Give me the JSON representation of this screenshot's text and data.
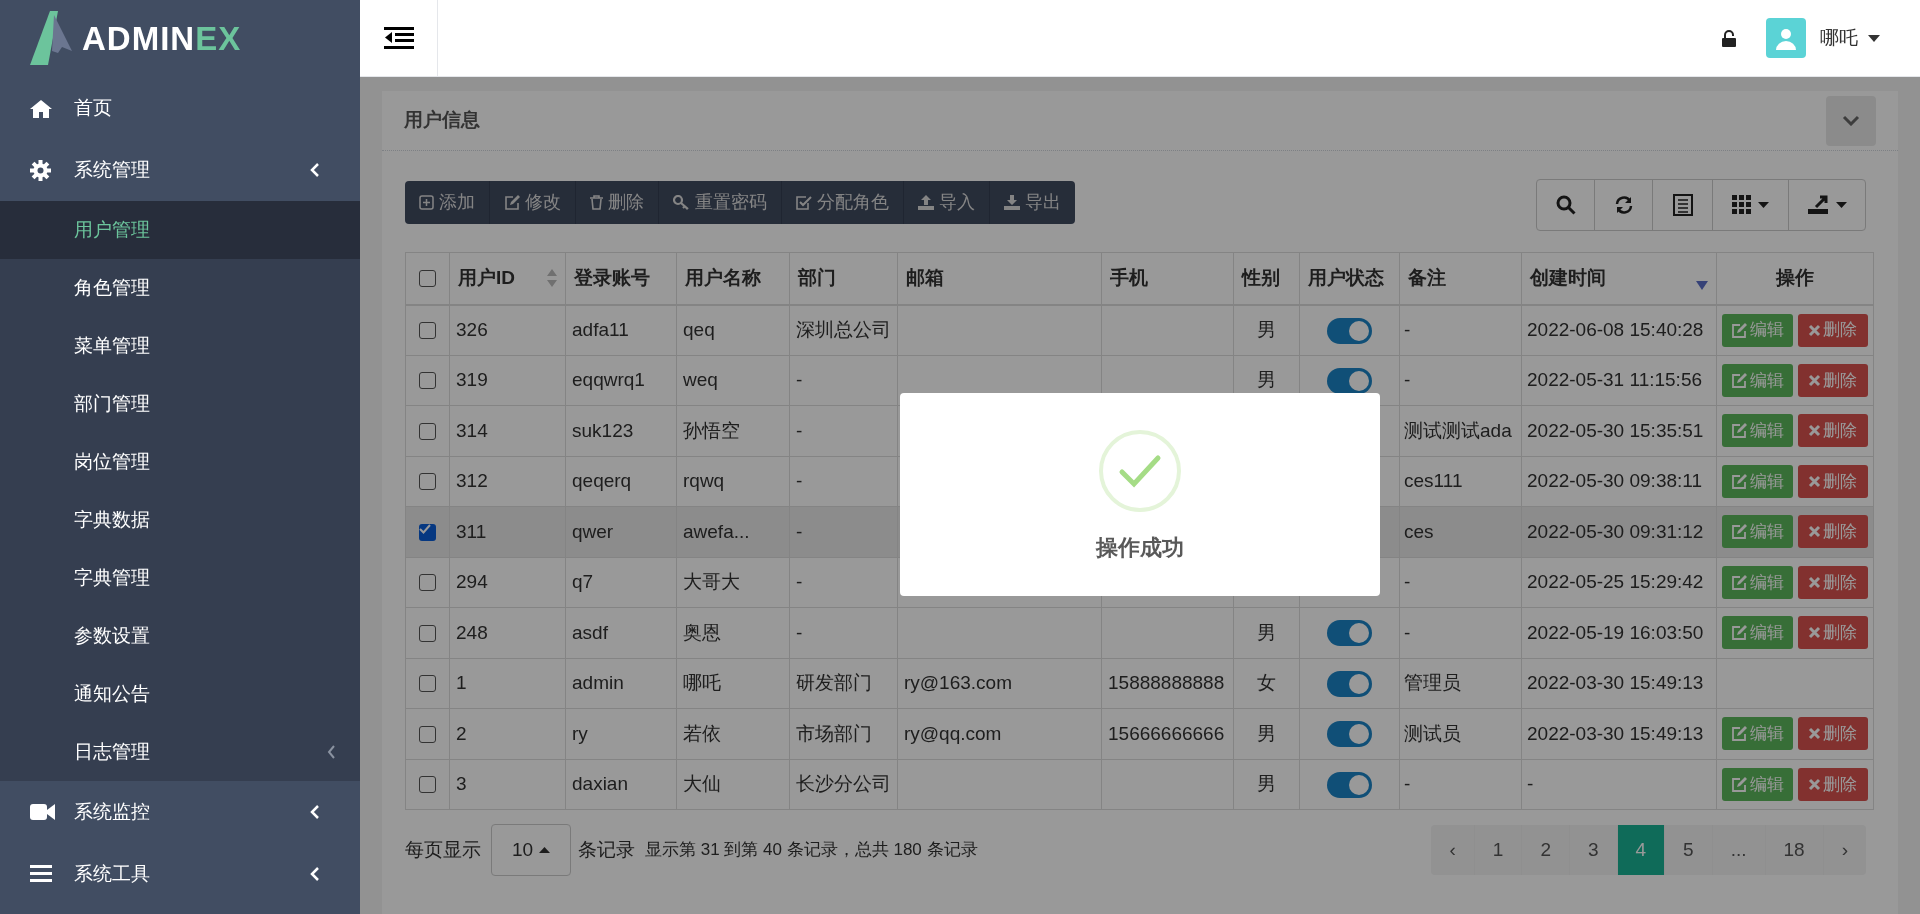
{
  "logo": {
    "text_main": "ADMIN",
    "text_accent": "EX"
  },
  "sidebar": {
    "items": [
      {
        "label": "首页",
        "has_submenu": false
      },
      {
        "label": "系统管理",
        "has_submenu": true,
        "children": [
          {
            "label": "用户管理",
            "selected": true,
            "has_submenu": false
          },
          {
            "label": "角色管理",
            "selected": false,
            "has_submenu": false
          },
          {
            "label": "菜单管理",
            "selected": false,
            "has_submenu": false
          },
          {
            "label": "部门管理",
            "selected": false,
            "has_submenu": false
          },
          {
            "label": "岗位管理",
            "selected": false,
            "has_submenu": false
          },
          {
            "label": "字典数据",
            "selected": false,
            "has_submenu": false
          },
          {
            "label": "字典管理",
            "selected": false,
            "has_submenu": false
          },
          {
            "label": "参数设置",
            "selected": false,
            "has_submenu": false
          },
          {
            "label": "通知公告",
            "selected": false,
            "has_submenu": false
          },
          {
            "label": "日志管理",
            "selected": false,
            "has_submenu": true
          }
        ]
      },
      {
        "label": "系统监控",
        "has_submenu": true
      },
      {
        "label": "系统工具",
        "has_submenu": true
      }
    ]
  },
  "header": {
    "user_name": "哪吒"
  },
  "panel": {
    "title": "用户信息"
  },
  "toolbar": {
    "buttons": [
      "添加",
      "修改",
      "删除",
      "重置密码",
      "分配角色",
      "导入",
      "导出"
    ]
  },
  "table": {
    "select_all_checked": false,
    "columns": [
      {
        "label": "用户ID",
        "sorted_desc": false
      },
      {
        "label": "登录账号"
      },
      {
        "label": "用户名称"
      },
      {
        "label": "部门"
      },
      {
        "label": "邮箱"
      },
      {
        "label": "手机"
      },
      {
        "label": "性别"
      },
      {
        "label": "用户状态"
      },
      {
        "label": "备注"
      },
      {
        "label": "创建时间",
        "sorted_desc": true
      },
      {
        "label": "操作"
      }
    ],
    "rows": [
      {
        "checked": false,
        "cells": [
          "326",
          "adfa11",
          "qeq",
          "深圳总公司",
          "",
          "",
          "男"
        ],
        "status_on": true,
        "remark": "-",
        "created": "2022-06-08 15:40:28",
        "actions": [
          "编辑",
          "删除"
        ]
      },
      {
        "checked": false,
        "cells": [
          "319",
          "eqqwrq1",
          "weq",
          "-",
          "",
          "",
          "男"
        ],
        "status_on": true,
        "remark": "-",
        "created": "2022-05-31 11:15:56",
        "actions": [
          "编辑",
          "删除"
        ]
      },
      {
        "checked": false,
        "cells": [
          "314",
          "suk123",
          "孙悟空",
          "-"
        ],
        "remark": "测试测试ada",
        "created": "2022-05-30 15:35:51",
        "actions": [
          "编辑",
          "删除"
        ]
      },
      {
        "checked": false,
        "cells": [
          "312",
          "qeqerq",
          "rqwq",
          "-"
        ],
        "remark": "ces111",
        "created": "2022-05-30 09:38:11",
        "actions": [
          "编辑",
          "删除"
        ]
      },
      {
        "checked": true,
        "cells": [
          "311",
          "qwer",
          "awefa...",
          "-"
        ],
        "remark": "ces",
        "created": "2022-05-30 09:31:12",
        "actions": [
          "编辑",
          "删除"
        ]
      },
      {
        "checked": false,
        "cells": [
          "294",
          "q7",
          "大哥大",
          "-"
        ],
        "remark": "-",
        "created": "2022-05-25 15:29:42",
        "actions": [
          "编辑",
          "删除"
        ]
      },
      {
        "checked": false,
        "cells": [
          "248",
          "asdf",
          "奥恩",
          "-",
          "",
          "",
          "男"
        ],
        "status_on": true,
        "remark": "-",
        "created": "2022-05-19 16:03:50",
        "actions": [
          "编辑",
          "删除"
        ]
      },
      {
        "checked": false,
        "cells": [
          "1",
          "admin",
          "哪吒",
          "研发部门",
          "ry@163.com",
          "15888888888",
          "女"
        ],
        "status_on": true,
        "remark": "管理员",
        "created": "2022-03-30 15:49:13",
        "actions": []
      },
      {
        "checked": false,
        "cells": [
          "2",
          "ry",
          "若依",
          "市场部门",
          "ry@qq.com",
          "15666666666",
          "男"
        ],
        "status_on": true,
        "remark": "测试员",
        "created": "2022-03-30 15:49:13",
        "actions": [
          "编辑",
          "删除"
        ]
      },
      {
        "checked": false,
        "cells": [
          "3",
          "daxian",
          "大仙",
          "长沙分公司",
          "",
          "",
          "男"
        ],
        "status_on": true,
        "remark": "-",
        "created": "-",
        "actions": [
          "编辑",
          "删除"
        ]
      }
    ]
  },
  "footer": {
    "per_page_label": "每页显示",
    "page_size": "10",
    "records_label": "条记录",
    "summary": "显示第 31 到第 40 条记录，总共 180 条记录"
  },
  "pagination": {
    "prev": "‹",
    "next": "›",
    "pages": [
      {
        "label": "1",
        "selected": false
      },
      {
        "label": "2",
        "selected": false
      },
      {
        "label": "3",
        "selected": false
      },
      {
        "label": "4",
        "selected": true
      },
      {
        "label": "5",
        "selected": false
      },
      {
        "label": "...",
        "selected": false
      },
      {
        "label": "18",
        "selected": false
      }
    ]
  },
  "dialog": {
    "message": "操作成功"
  }
}
